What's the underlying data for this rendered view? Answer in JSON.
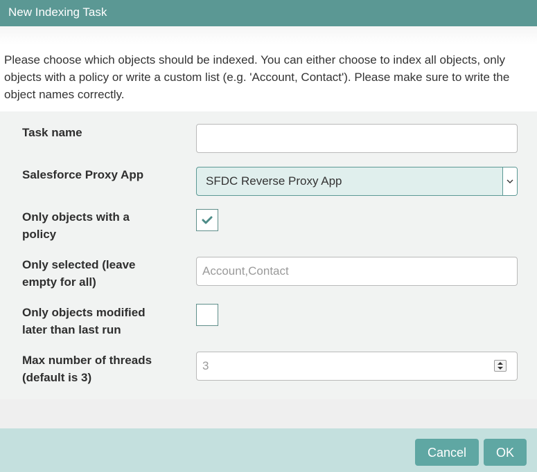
{
  "dialog": {
    "title": "New Indexing Task",
    "intro": "Please choose which objects should be indexed. You can either choose to index all objects, only objects with a policy or write a custom list (e.g. 'Account, Contact'). Please make sure to write the object names correctly."
  },
  "form": {
    "task_name": {
      "label": "Task name",
      "value": ""
    },
    "proxy_app": {
      "label": "Salesforce Proxy App",
      "selected": "SFDC Reverse Proxy App"
    },
    "only_with_policy": {
      "label": "Only objects with a policy",
      "checked": true
    },
    "only_selected": {
      "label": "Only selected (leave empty for all)",
      "value": "",
      "placeholder": "Account,Contact"
    },
    "modified_since_last_run": {
      "label": "Only objects modified later than last run",
      "checked": false
    },
    "max_threads": {
      "label": "Max number of threads (default is 3)",
      "value": "",
      "placeholder": "3"
    }
  },
  "footer": {
    "cancel_label": "Cancel",
    "ok_label": "OK"
  },
  "colors": {
    "title_bar": "#5b9894",
    "accent": "#5fa7a3",
    "footer_bg": "#c4e0de",
    "form_bg": "#f1f3f2"
  },
  "icons": [
    "chevron-down-icon",
    "checkmark-icon",
    "spinner-arrows-icon"
  ]
}
